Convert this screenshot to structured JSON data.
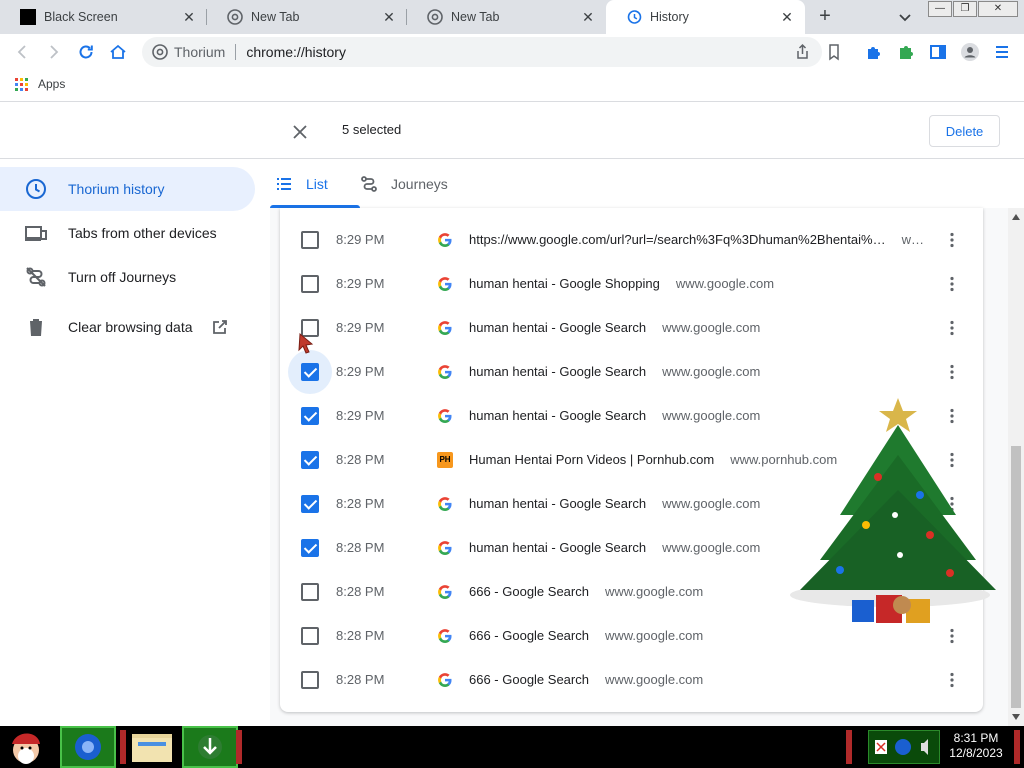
{
  "browser": {
    "tabs": [
      {
        "title": "Black Screen",
        "active": false
      },
      {
        "title": "New Tab",
        "active": false
      },
      {
        "title": "New Tab",
        "active": false
      },
      {
        "title": "History",
        "active": true
      }
    ],
    "omnibox": {
      "site": "Thorium",
      "url": "chrome://history"
    },
    "bookmarks": [
      {
        "label": "Apps"
      }
    ]
  },
  "history": {
    "selection": {
      "count_label": "5 selected",
      "delete_label": "Delete"
    },
    "sidebar": {
      "items": [
        {
          "label": "Thorium history",
          "icon": "clock-icon",
          "active": true
        },
        {
          "label": "Tabs from other devices",
          "icon": "devices-icon",
          "active": false
        },
        {
          "label": "Turn off Journeys",
          "icon": "journeys-off-icon",
          "active": false
        },
        {
          "label": "Clear browsing data",
          "icon": "trash-icon",
          "active": false
        }
      ]
    },
    "tabs": [
      {
        "label": "List",
        "active": true
      },
      {
        "label": "Journeys",
        "active": false
      }
    ],
    "rows": [
      {
        "time": "8:29 PM",
        "title": "https://www.google.com/url?url=/search%3Fq%3Dhuman%2Bhentai%…",
        "domain": "w…",
        "favicon": "google",
        "checked": false
      },
      {
        "time": "8:29 PM",
        "title": "human hentai - Google Shopping",
        "domain": "www.google.com",
        "favicon": "google",
        "checked": false
      },
      {
        "time": "8:29 PM",
        "title": "human hentai - Google Search",
        "domain": "www.google.com",
        "favicon": "google",
        "checked": false
      },
      {
        "time": "8:29 PM",
        "title": "human hentai - Google Search",
        "domain": "www.google.com",
        "favicon": "google",
        "checked": true
      },
      {
        "time": "8:29 PM",
        "title": "human hentai - Google Search",
        "domain": "www.google.com",
        "favicon": "google",
        "checked": true
      },
      {
        "time": "8:28 PM",
        "title": "Human Hentai Porn Videos | Pornhub.com",
        "domain": "www.pornhub.com",
        "favicon": "pornhub",
        "checked": true
      },
      {
        "time": "8:28 PM",
        "title": "human hentai - Google Search",
        "domain": "www.google.com",
        "favicon": "google",
        "checked": true
      },
      {
        "time": "8:28 PM",
        "title": "human hentai - Google Search",
        "domain": "www.google.com",
        "favicon": "google",
        "checked": true
      },
      {
        "time": "8:28 PM",
        "title": "666 - Google Search",
        "domain": "www.google.com",
        "favicon": "google",
        "checked": false
      },
      {
        "time": "8:28 PM",
        "title": "666 - Google Search",
        "domain": "www.google.com",
        "favicon": "google",
        "checked": false
      },
      {
        "time": "8:28 PM",
        "title": "666 - Google Search",
        "domain": "www.google.com",
        "favicon": "google",
        "checked": false
      }
    ]
  },
  "taskbar": {
    "clock": {
      "time": "8:31 PM",
      "date": "12/8/2023"
    }
  },
  "colors": {
    "accent": "#1a73e8",
    "active_bg": "#e8f0fe"
  },
  "favicon_letters": {
    "pornhub": "PH"
  }
}
